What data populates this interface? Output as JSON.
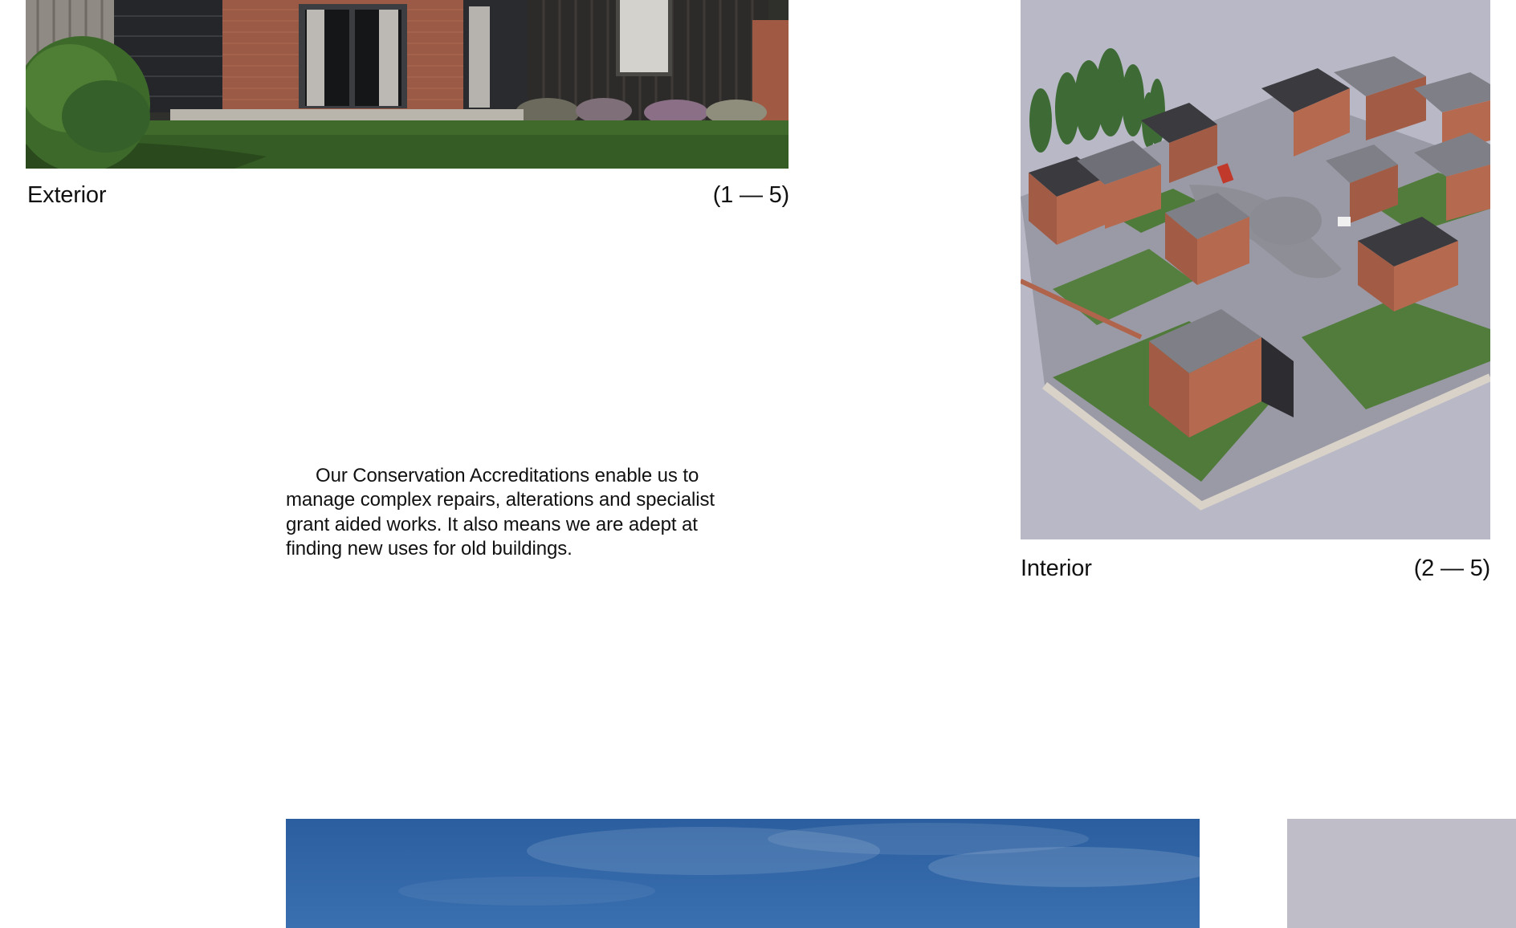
{
  "gallery": {
    "items": [
      {
        "title": "Exterior",
        "counter": "(1 — 5)"
      },
      {
        "title": "Interior",
        "counter": "(2 — 5)"
      }
    ]
  },
  "intro": {
    "text": "Our Conservation Accreditations enable us to manage complex repairs, alterations and specialist grant aided works. It also means we are adept at finding new uses for old buildings."
  },
  "colors": {
    "background": "#ffffff",
    "text": "#111111",
    "aerial_background": "#b8b8c6",
    "sky": "#2d62a4",
    "placeholder_grey": "#bfbec8"
  }
}
